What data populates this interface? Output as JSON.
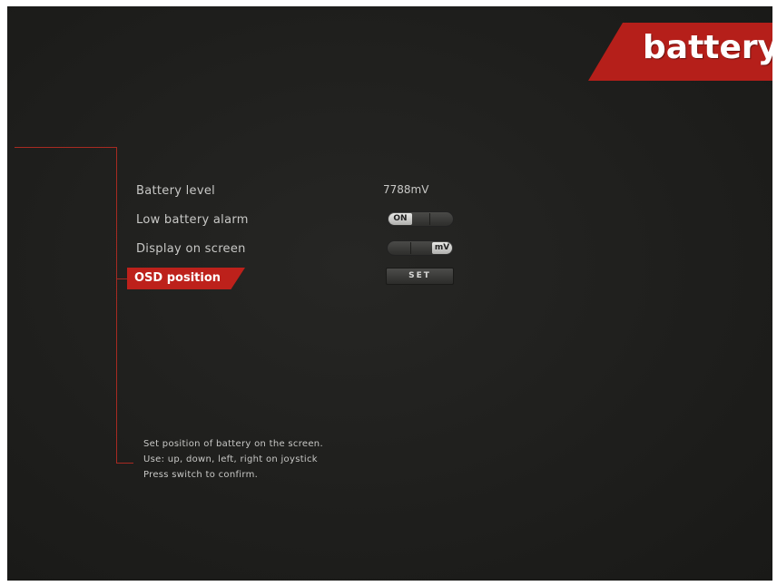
{
  "header": {
    "title": "battery",
    "accent_color": "#b51f1a"
  },
  "menu": {
    "items": [
      {
        "label": "Battery level",
        "control": "value",
        "value": "7788mV"
      },
      {
        "label": "Low battery alarm",
        "control": "toggle",
        "toggle_label": "ON"
      },
      {
        "label": "Display on screen",
        "control": "toggle",
        "toggle_label": "mV"
      },
      {
        "label": "OSD position",
        "control": "button",
        "button_label": "SET",
        "selected": true
      }
    ]
  },
  "help": {
    "lines": [
      "Set position of battery on the screen.",
      "Use: up, down, left, right on joystick",
      "Press switch to confirm."
    ]
  }
}
